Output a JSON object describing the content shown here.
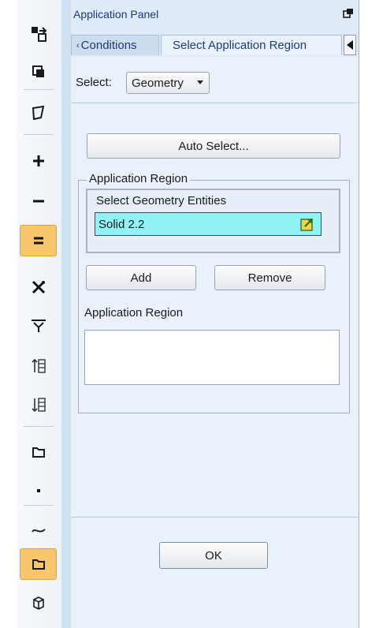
{
  "toolbar": {
    "buttons": [
      {
        "name": "move-entity-icon",
        "active": false
      },
      {
        "name": "copy-entity-icon",
        "active": false
      },
      {
        "name": "surface-icon",
        "active": false
      },
      {
        "name": "plus-icon",
        "active": false
      },
      {
        "name": "minus-icon",
        "active": false
      },
      {
        "name": "equals-icon",
        "active": true
      },
      {
        "name": "cross-tools-icon",
        "active": false
      },
      {
        "name": "filter-pin-icon",
        "active": false
      },
      {
        "name": "list-move-up-icon",
        "active": false
      },
      {
        "name": "list-move-down-icon",
        "active": false
      },
      {
        "name": "face-icon",
        "active": false
      },
      {
        "name": "point-icon",
        "active": false
      },
      {
        "name": "edge-curve-icon",
        "active": false
      },
      {
        "name": "face-select-icon",
        "active": true
      },
      {
        "name": "solid-icon",
        "active": false
      }
    ],
    "colors": {
      "active_fill": "#f8c66d",
      "active_border": "#e0a236"
    }
  },
  "panel": {
    "title": "Application Panel",
    "tabs": [
      {
        "label": "Conditions",
        "active": false
      },
      {
        "label": "Select Application Region",
        "active": true
      }
    ],
    "select_label": "Select:",
    "select_value": "Geometry",
    "auto_select_button": "Auto Select...",
    "group_title": "Application Region",
    "entities_label": "Select Geometry Entities",
    "entities_value": "Solid 2.2",
    "add_button": "Add",
    "remove_button": "Remove",
    "region_label": "Application Region",
    "region_items": [],
    "ok_button": "OK",
    "colors": {
      "panel_bg": "#e9f1fa",
      "title_text": "#1e3a78",
      "field_highlight": "#8ff3f5"
    }
  }
}
